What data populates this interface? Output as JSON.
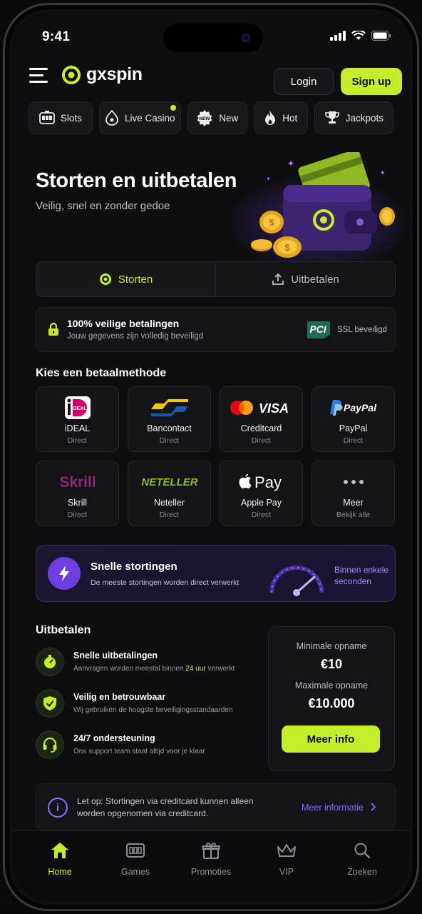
{
  "status": {
    "time": "9:41"
  },
  "header": {
    "brand": "gxspin",
    "login_label": "Login",
    "signup_label": "Sign up"
  },
  "categories": [
    {
      "label": "Slots",
      "icon": "slot-machine-icon"
    },
    {
      "label": "Live Casino",
      "icon": "live-casino-icon"
    },
    {
      "label": "New",
      "icon": "new-badge-icon"
    },
    {
      "label": "Hot",
      "icon": "flame-icon"
    },
    {
      "label": "Jackpots",
      "icon": "trophy-icon"
    }
  ],
  "hero": {
    "title": "Storten en uitbetalen",
    "subtitle": "Veilig, snel en zonder gedoe"
  },
  "tabs": {
    "deposit": "Storten",
    "withdraw": "Uitbetalen"
  },
  "secure": {
    "title": "100% veilige betalingen",
    "subtitle": "Jouw gegevens zijn volledig beveiligd",
    "badge": "SSL beveiligd"
  },
  "methods": {
    "heading": "Kies een betaalmethode",
    "items": [
      {
        "name": "iDEAL",
        "sub": "Direct"
      },
      {
        "name": "Bancontact",
        "sub": "Direct"
      },
      {
        "name": "Creditcard",
        "sub": "Direct"
      },
      {
        "name": "PayPal",
        "sub": "Direct"
      },
      {
        "name": "Skrill",
        "sub": "Direct"
      },
      {
        "name": "Neteller",
        "sub": "Direct"
      },
      {
        "name": "Apple Pay",
        "sub": "Direct"
      },
      {
        "name": "Meer",
        "sub": "Bekijk alle"
      }
    ],
    "logos": {
      "ideal": "iDEAL",
      "visa": "VISA",
      "paypal": "PayPal",
      "skrill": "Skrill",
      "neteller": "NETELLER",
      "applepay": "Pay"
    }
  },
  "fast": {
    "title": "Snelle stortingen",
    "subtitle": "De meeste stortingen worden direct verwerkt",
    "note": "Binnen enkele seconden"
  },
  "payouts": {
    "heading": "Uitbetalen",
    "features": [
      {
        "title": "Snelle uitbetalingen",
        "desc_pre": "Aanvragen worden meestal binnen ",
        "desc_hl": "24 uur",
        "desc_post": " verwerkt"
      },
      {
        "title": "Veilig en betrouwbaar",
        "desc": "Wij gebruiken de hoogste beveiligingsstandaarden"
      },
      {
        "title": "24/7 ondersteuning",
        "desc": "Ons support team staat altijd voor je klaar"
      }
    ],
    "min_label": "Minimale opname",
    "min_value": "€10",
    "max_label": "Maximale opname",
    "max_value": "€10.000",
    "more_label": "Meer info"
  },
  "notice": {
    "text": "Let op: Stortingen via creditcard kunnen alleen worden opgenomen via creditcard.",
    "link": "Meer informatie"
  },
  "nav": [
    {
      "label": "Home",
      "icon": "home-icon"
    },
    {
      "label": "Games",
      "icon": "games-icon"
    },
    {
      "label": "Promoties",
      "icon": "gift-icon"
    },
    {
      "label": "VIP",
      "icon": "crown-icon"
    },
    {
      "label": "Zoeken",
      "icon": "search-icon"
    }
  ],
  "colors": {
    "accent": "#c4ee2a",
    "purple": "#8b6cff",
    "background": "#0e0e10"
  }
}
